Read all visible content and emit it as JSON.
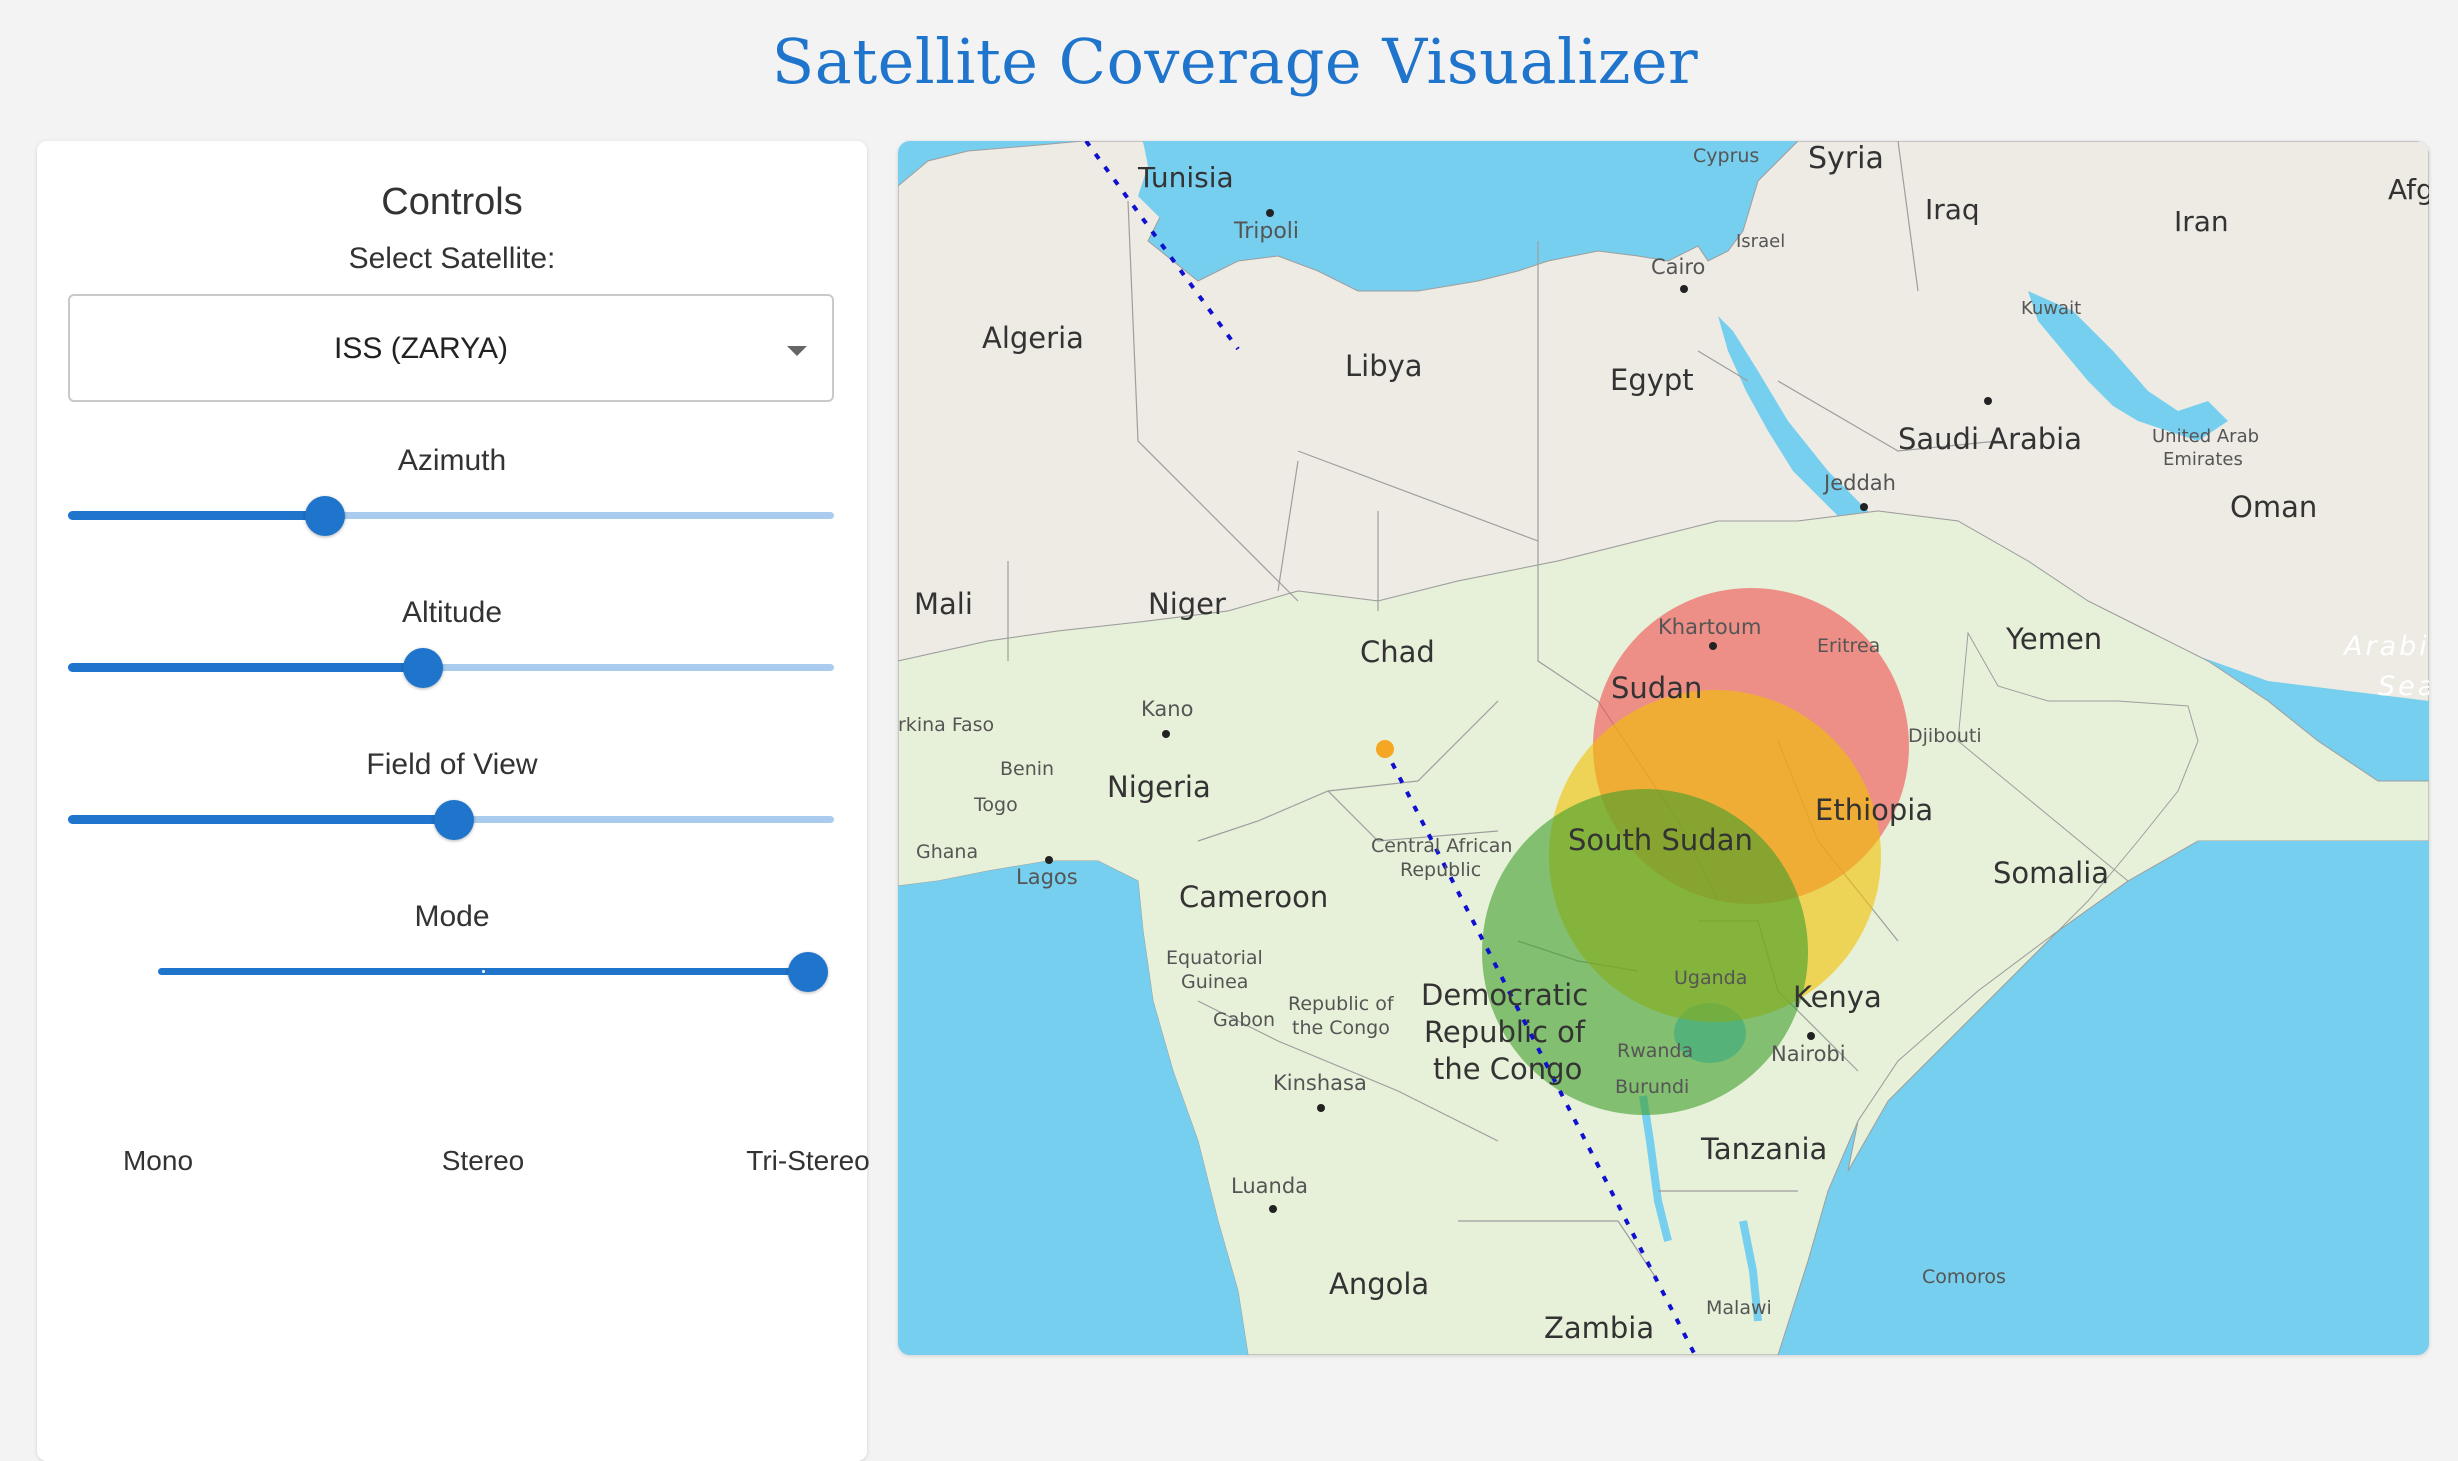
{
  "app": {
    "title": "Satellite Coverage Visualizer"
  },
  "controls": {
    "heading": "Controls",
    "select_label": "Select Satellite:",
    "satellite": "ISS (ZARYA)",
    "azimuth": {
      "label": "Azimuth",
      "value_fraction": 0.335
    },
    "altitude": {
      "label": "Altitude",
      "value_fraction": 0.463
    },
    "fov": {
      "label": "Field of View",
      "value_fraction": 0.504
    },
    "mode": {
      "label": "Mode",
      "options": [
        "Mono",
        "Stereo",
        "Tri-Stereo"
      ],
      "selected": "Tri-Stereo"
    }
  },
  "map": {
    "labels": {
      "tunisia": "Tunisia",
      "tripoli": "Tripoli",
      "cyprus": "Cyprus",
      "syria": "Syria",
      "iraq": "Iraq",
      "iran": "Iran",
      "afg": "Afg",
      "israel": "Israel",
      "cairo": "Cairo",
      "kuwait": "Kuwait",
      "algeria": "Algeria",
      "libya": "Libya",
      "egypt": "Egypt",
      "saudi": "Saudi Arabia",
      "uae1": "United Arab",
      "uae2": "Emirates",
      "jeddah": "Jeddah",
      "oman": "Oman",
      "mali": "Mali",
      "niger": "Niger",
      "chad": "Chad",
      "khartoum": "Khartoum",
      "eritrea": "Eritrea",
      "yemen": "Yemen",
      "arabi": "Arabi",
      "sea": "Sea",
      "sudan": "Sudan",
      "burkina": "rkina Faso",
      "kano": "Kano",
      "djibouti": "Djibouti",
      "benin": "Benin",
      "nigeria": "Nigeria",
      "togo": "Togo",
      "ethiopia": "Ethiopia",
      "ghana": "Ghana",
      "lagos": "Lagos",
      "car1": "Central African",
      "car2": "Republic",
      "southsudan": "South Sudan",
      "somalia": "Somalia",
      "cameroon": "Cameroon",
      "eqg1": "Equatorial",
      "eqg2": "Guinea",
      "uganda": "Uganda",
      "drc1": "Democratic",
      "drc2": "Republic of",
      "drc3": "the Congo",
      "roc1": "Republic of",
      "roc2": "the Congo",
      "kenya": "Kenya",
      "gabon": "Gabon",
      "rwanda": "Rwanda",
      "nairobi": "Nairobi",
      "burundi": "Burundi",
      "kinshasa": "Kinshasa",
      "tanzania": "Tanzania",
      "luanda": "Luanda",
      "angola": "Angola",
      "comoros": "Comoros",
      "malawi": "Malawi",
      "zambia": "Zambia"
    },
    "coverage_colors": [
      "#f05a5a",
      "#f0c020",
      "#4caf3c"
    ],
    "ground_track_color": "#1010d0"
  }
}
